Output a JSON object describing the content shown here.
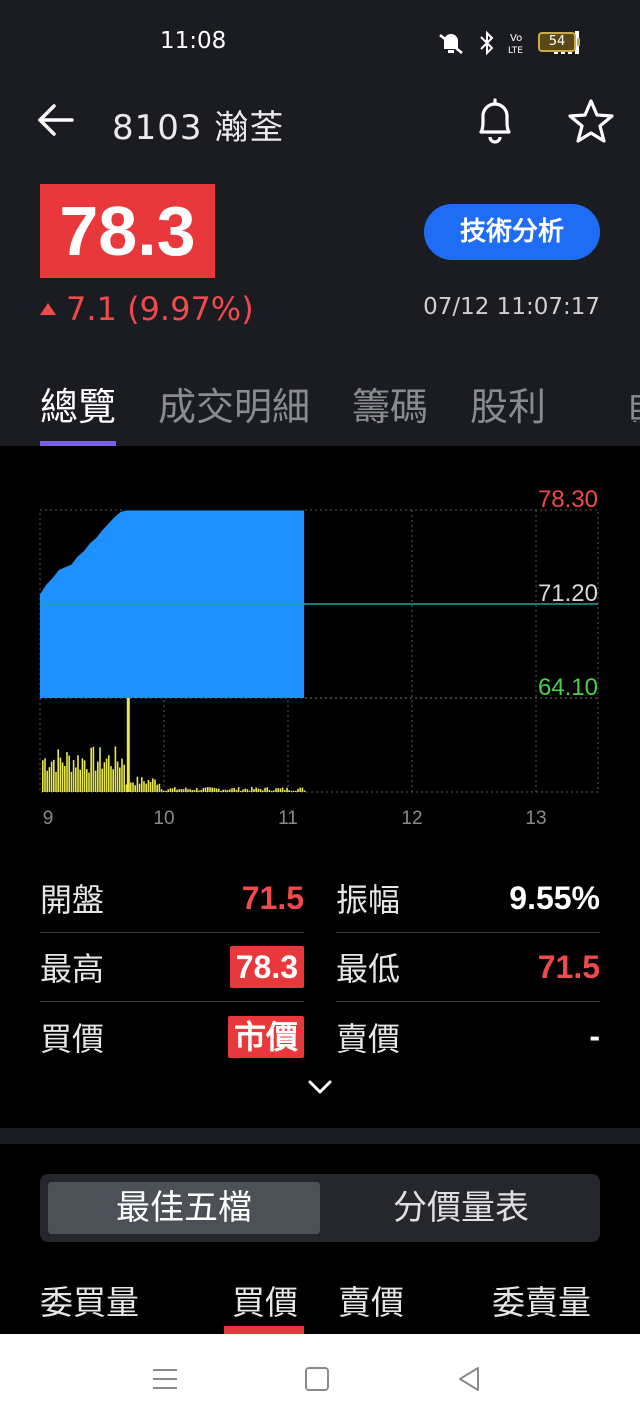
{
  "status_bar": {
    "time": "11:08",
    "battery": "54",
    "icons": [
      "mute-icon",
      "bluetooth-icon",
      "volte-icon",
      "signal-4g-icon",
      "battery-icon"
    ]
  },
  "header": {
    "title": "8103 瀚荃",
    "back_icon": "back-arrow-icon",
    "bell_icon": "bell-icon",
    "star_icon": "star-icon"
  },
  "quote": {
    "price": "78.3",
    "change": "7.1 (9.97%)",
    "timestamp": "07/12 11:07:17",
    "tech_button": "技術分析"
  },
  "tabs": [
    {
      "label": "總覽",
      "active": true
    },
    {
      "label": "成交明細",
      "active": false
    },
    {
      "label": "籌碼",
      "active": false
    },
    {
      "label": "股利",
      "active": false
    }
  ],
  "chart_data": {
    "type": "area",
    "price_labels": {
      "high": "78.30",
      "ref": "71.20",
      "low": "64.10"
    },
    "x_ticks": [
      "9",
      "10",
      "11",
      "12",
      "13"
    ],
    "ylim": [
      64.1,
      78.3
    ],
    "reference": 71.2,
    "price_series": {
      "x": [
        9.0,
        9.05,
        9.1,
        9.15,
        9.2,
        9.25,
        9.3,
        9.35,
        9.4,
        9.45,
        9.5,
        9.55,
        9.6,
        9.65,
        9.7,
        10.0,
        10.5,
        11.0,
        11.13
      ],
      "y": [
        72.0,
        72.7,
        73.2,
        73.8,
        74.0,
        74.2,
        74.8,
        75.2,
        75.8,
        76.2,
        76.8,
        77.3,
        77.8,
        78.2,
        78.3,
        78.3,
        78.3,
        78.3,
        78.3
      ]
    },
    "volume_series": {
      "spike_at": 9.7,
      "profile": "high early, tapering after 10:00"
    },
    "colors": {
      "area": "#1e90ff",
      "volume": "#e8e84a",
      "ref_line": "#1aa7a0",
      "high": "#f04a4a",
      "low": "#4ccf4c"
    }
  },
  "stats": {
    "open_label": "開盤",
    "open_value": "71.5",
    "amp_label": "振幅",
    "amp_value": "9.55%",
    "high_label": "最高",
    "high_value": "78.3",
    "low_label": "最低",
    "low_value": "71.5",
    "bid_label": "買價",
    "bid_value": "市價",
    "ask_label": "賣價",
    "ask_value": "-"
  },
  "order_book": {
    "seg_best5": "最佳五檔",
    "seg_price_vol": "分價量表",
    "col_bid_qty": "委買量",
    "col_bid": "買價",
    "col_ask": "賣價",
    "col_ask_qty": "委賣量"
  },
  "nav": {
    "menu_icon": "menu-icon",
    "home_icon": "home-icon",
    "back_icon": "nav-back-icon"
  },
  "colors": {
    "up_red": "#e8383b",
    "accent_blue": "#1f6cf5",
    "tab_underline": "#7d5cff"
  }
}
